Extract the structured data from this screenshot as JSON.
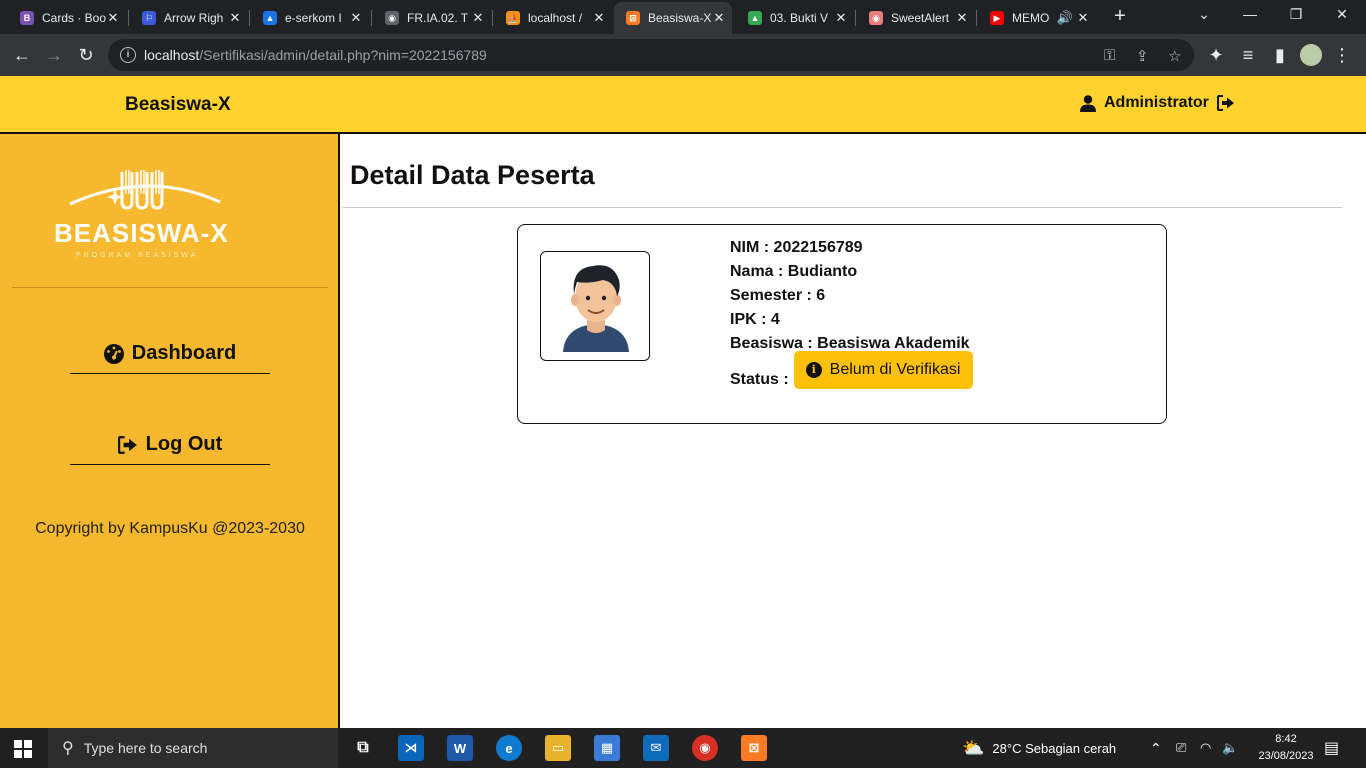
{
  "browser": {
    "tabs": [
      {
        "title": "Cards · Boo",
        "color": "#7952b3",
        "glyph": "B"
      },
      {
        "title": "Arrow Righ",
        "color": "#3b5bdb",
        "glyph": "⚐"
      },
      {
        "title": "e-serkom I",
        "color": "#1a73e8",
        "glyph": "▲"
      },
      {
        "title": "FR.IA.02. T",
        "color": "#5f6368",
        "glyph": "◉"
      },
      {
        "title": "localhost /",
        "color": "#f29111",
        "glyph": "⛵"
      },
      {
        "title": "Beasiswa-X",
        "color": "#fb7a24",
        "glyph": "⊠"
      },
      {
        "title": "03. Bukti V",
        "color": "#34a853",
        "glyph": "▲"
      },
      {
        "title": "SweetAlert",
        "color": "#e87c7c",
        "glyph": "◉"
      },
      {
        "title": "MEMO",
        "color": "#ff0000",
        "glyph": "▶"
      }
    ],
    "url_host": "localhost",
    "url_path": "/Sertifikasi/admin/detail.php?nim=2022156789"
  },
  "header": {
    "brand": "Beasiswa-X",
    "user": "Administrator"
  },
  "sidebar": {
    "logo_text": "BEASISWA-X",
    "logo_sub": "PROGRAM BEASISWA",
    "menu": {
      "dashboard": "Dashboard",
      "logout": "Log Out"
    },
    "copyright": "Copyright by KampusKu @2023-2030"
  },
  "main": {
    "title": "Detail Data Peserta",
    "participant": {
      "nim": "NIM : 2022156789",
      "nama": "Nama : Budianto",
      "semester": "Semester : 6",
      "ipk": "IPK : 4",
      "beasiswa": "Beasiswa : Beasiswa Akademik",
      "status_label": "Status :",
      "status_value": "Belum di Verifikasi"
    }
  },
  "taskbar": {
    "search_placeholder": "Type here to search",
    "weather": "28°C  Sebagian cerah",
    "time": "8:42",
    "date": "23/08/2023"
  },
  "colors": {
    "header": "#ffd22e",
    "sidebar": "#f5b82e",
    "badge": "#ffc107"
  }
}
